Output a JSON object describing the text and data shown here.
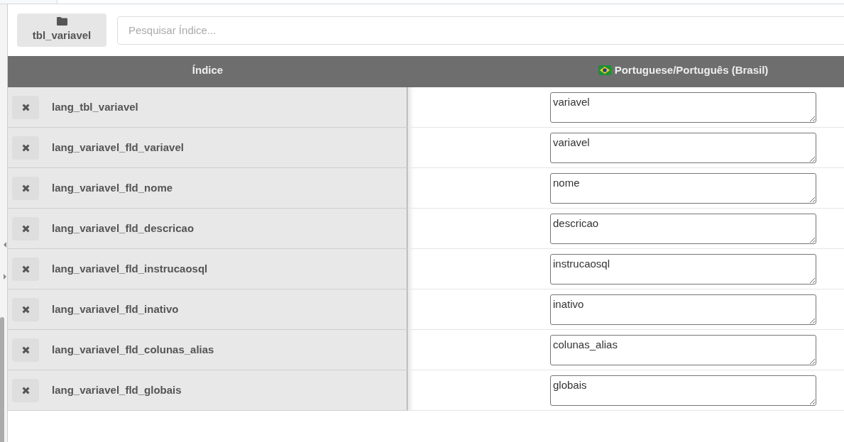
{
  "toolbar": {
    "folder_button": {
      "label": "tbl_variavel"
    },
    "search": {
      "placeholder": "Pesquisar Índice..."
    }
  },
  "table": {
    "columns": [
      {
        "kind": "text",
        "label": "Índice"
      },
      {
        "kind": "language",
        "label": "Portuguese/Português (Brasil)"
      }
    ],
    "rows": [
      {
        "key": "lang_tbl_variavel",
        "value": "variavel"
      },
      {
        "key": "lang_variavel_fld_variavel",
        "value": "variavel"
      },
      {
        "key": "lang_variavel_fld_nome",
        "value": "nome"
      },
      {
        "key": "lang_variavel_fld_descricao",
        "value": "descricao"
      },
      {
        "key": "lang_variavel_fld_instrucaosql",
        "value": "instrucaosql"
      },
      {
        "key": "lang_variavel_fld_inativo",
        "value": "inativo"
      },
      {
        "key": "lang_variavel_fld_colunas_alias",
        "value": "colunas_alias"
      },
      {
        "key": "lang_variavel_fld_globais",
        "value": "globais"
      }
    ]
  }
}
